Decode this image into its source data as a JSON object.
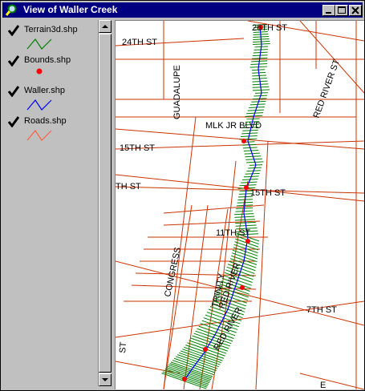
{
  "window": {
    "title": "View of Waller Creek",
    "controls": [
      "minimize-icon",
      "maximize-icon",
      "close-icon"
    ]
  },
  "legend": {
    "layers": [
      {
        "name": "Terrain3d.shp",
        "checked": true,
        "symbol": "green-zigzag-line",
        "color": "#008000"
      },
      {
        "name": "Bounds.shp",
        "checked": true,
        "symbol": "red-dot",
        "color": "#ff0000"
      },
      {
        "name": "Waller.shp",
        "checked": true,
        "symbol": "blue-zigzag-line",
        "color": "#0000ff"
      },
      {
        "name": "Roads.shp",
        "checked": true,
        "symbol": "red-zigzag-line",
        "color": "#ff6040"
      }
    ]
  },
  "map": {
    "street_labels": [
      "26TH ST",
      "24TH ST",
      "GUADALUPE",
      "RED RIVER ST",
      "MLK JR BLVD",
      "15TH ST",
      "15TH ST",
      "TH ST",
      "11TH ST",
      "CONGRESS",
      "TRINITY",
      "RED RIVER",
      "7TH ST",
      "RED RIVER",
      "ST",
      "E"
    ],
    "colors": {
      "roads": "#cc3300",
      "terrain": "#008000",
      "creek": "#0000ff",
      "bounds": "#ff0000"
    }
  }
}
